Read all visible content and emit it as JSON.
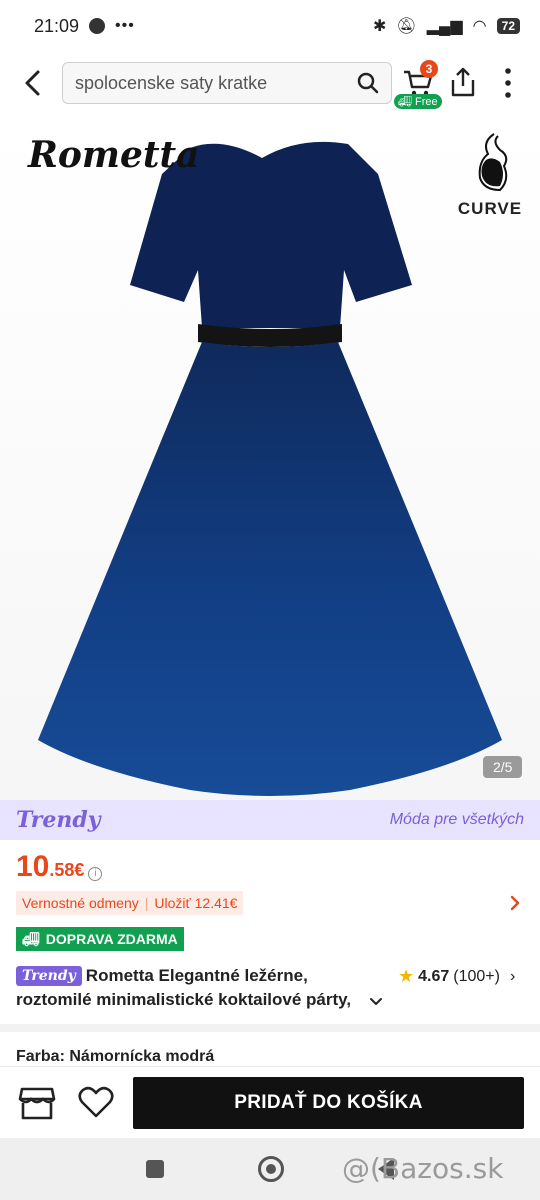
{
  "status_bar": {
    "time": "21:09",
    "battery": "72"
  },
  "search": {
    "query": "spolocenske saty kratke"
  },
  "cart": {
    "count": "3",
    "free_label": "Free"
  },
  "gallery": {
    "brand": "Rometta",
    "curve_label": "CURVE",
    "pager": "2/5"
  },
  "banner": {
    "logo": "Trendy",
    "tagline": "Móda pre všetkých"
  },
  "price": {
    "integer": "10",
    "decimal": ".58€"
  },
  "loyalty": {
    "label": "Vernostné odmeny",
    "save": "Uložiť 12.41€"
  },
  "shipping": {
    "label": "DOPRAVA ZDARMA"
  },
  "product": {
    "badge": "Trendy",
    "title_line1": "Rometta Elegantné ležérne,",
    "title_line2": "roztomilé minimalistické koktailové párty,",
    "rating": "4.67",
    "reviews": "(100+)"
  },
  "color": {
    "label": "Farba:",
    "value": "Námornícka modrá"
  },
  "actions": {
    "add_to_cart": "PRIDAŤ DO KOŠÍKA"
  },
  "watermark": "@(Bazos.sk",
  "colors": {
    "accent": "#e9471a",
    "green": "#11a04f",
    "purple": "#7b61d9",
    "dress": "#123a7a"
  }
}
